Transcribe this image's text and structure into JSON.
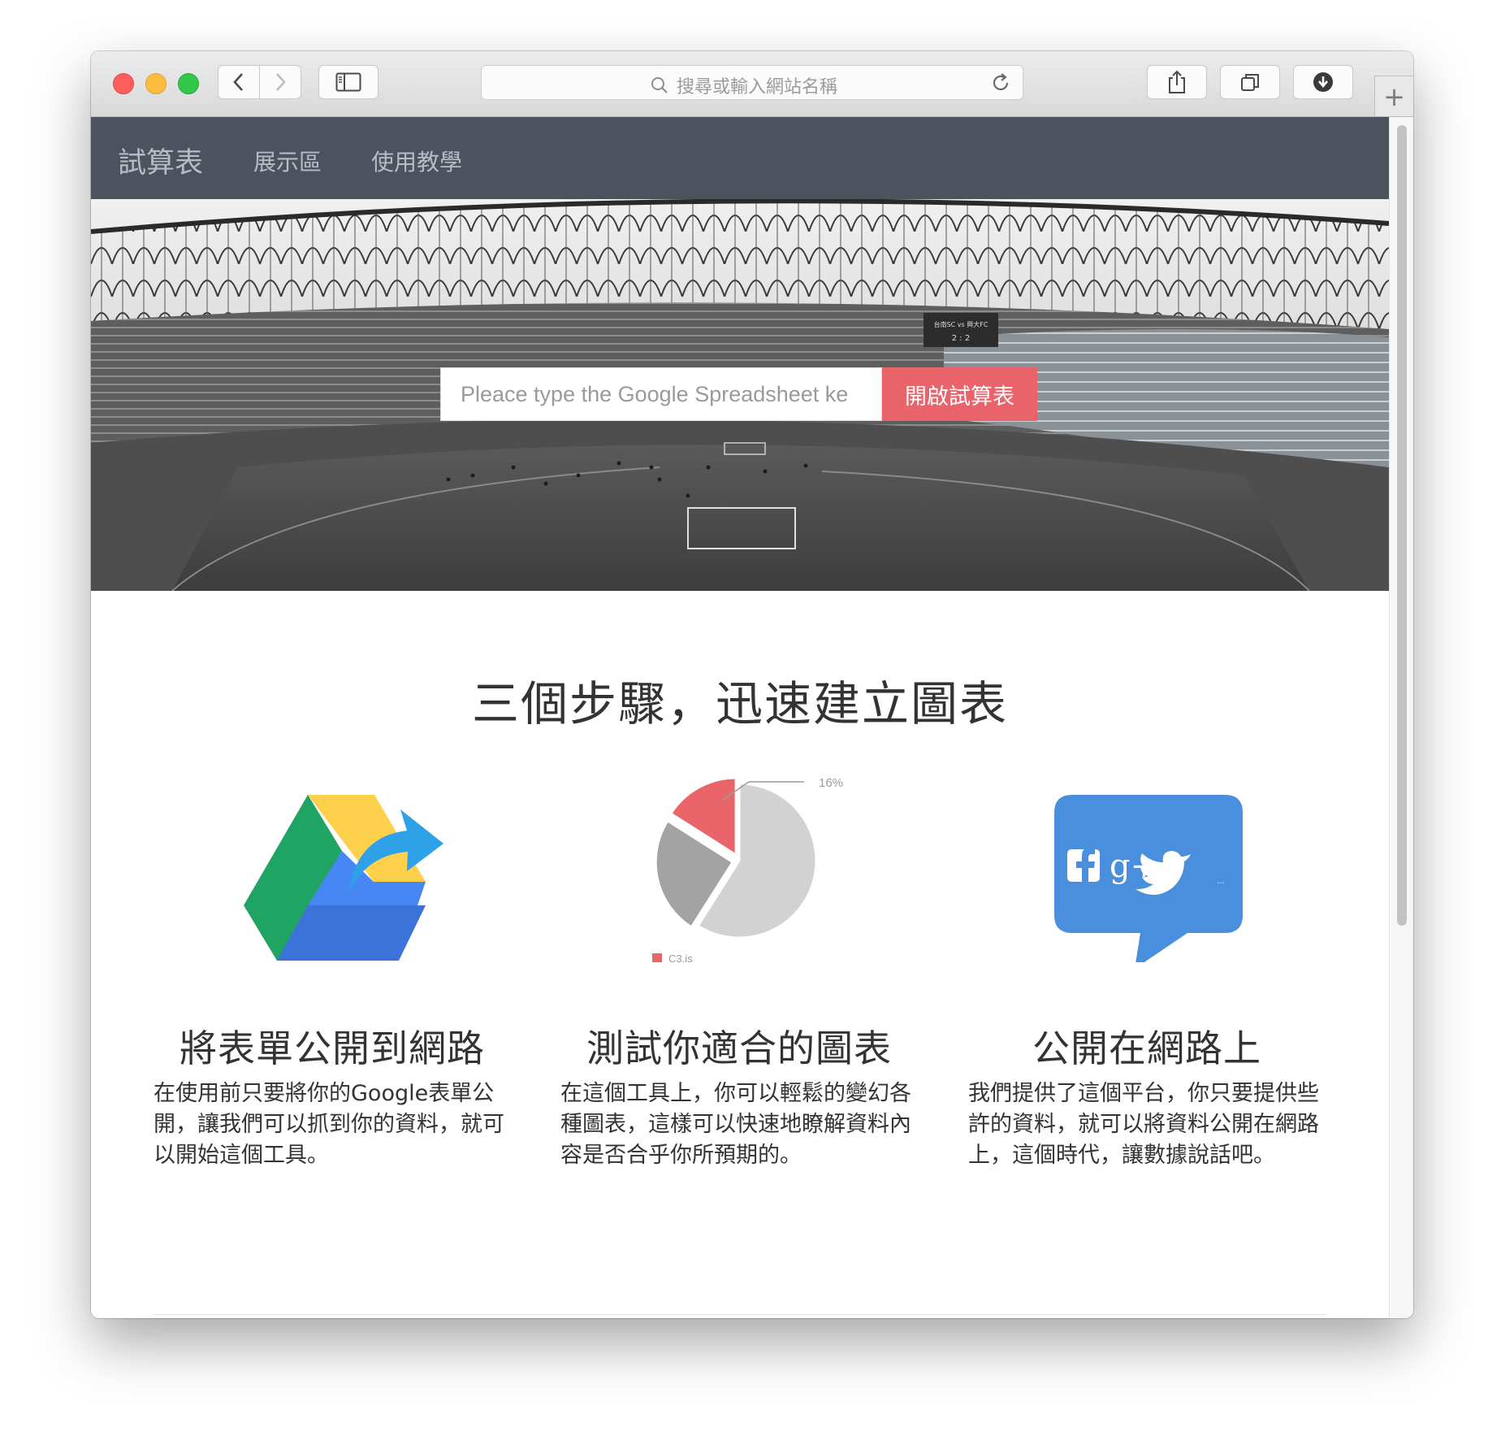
{
  "browser": {
    "address_placeholder": "搜尋或輸入網站名稱",
    "new_tab_label": "+"
  },
  "navbar": {
    "brand": "試算表",
    "items": [
      {
        "label": "展示區"
      },
      {
        "label": "使用教學"
      }
    ]
  },
  "hero": {
    "input_placeholder": "Pleace type the Google Spreadsheet ke",
    "button_label": "開啟試算表",
    "scoreboard": {
      "match": "台南SC vs 興大FC",
      "score": "2 : 2"
    }
  },
  "steps": {
    "title": "三個步驟，迅速建立圖表",
    "items": [
      {
        "icon": "google-drive-share-icon",
        "title": "將表單公開到網路",
        "desc": "在使用前只要將你的Google表單公開，讓我們可以抓到你的資料，就可以開始這個工具。"
      },
      {
        "icon": "pie-chart-icon",
        "title": "測試你適合的圖表",
        "desc": "在這個工具上，你可以輕鬆的變幻各種圖表，這樣可以快速地瞭解資料內容是否合乎你所預期的。"
      },
      {
        "icon": "social-share-bubble-icon",
        "title": "公開在網路上",
        "desc": "我們提供了這個平台，你只要提供些許的資料，就可以將資料公開在網路上，這個時代，讓數據說話吧。"
      }
    ]
  },
  "pie_icon": {
    "percent_label": "16%",
    "legend_label": "C3.js",
    "slices": [
      {
        "value": 16,
        "color": "#e86569"
      },
      {
        "value": 59,
        "color": "#d2d2d2"
      },
      {
        "value": 25,
        "color": "#a3a3a3"
      }
    ]
  },
  "social_icon": {
    "gplus_text": "g+",
    "more_text": "..."
  },
  "colors": {
    "navbar": "#4d535e",
    "accent": "#e8646a",
    "drive_green": "#1fa463",
    "drive_yellow": "#ffd04b",
    "drive_blue": "#4687f4",
    "social_blue": "#4a8fdd"
  }
}
